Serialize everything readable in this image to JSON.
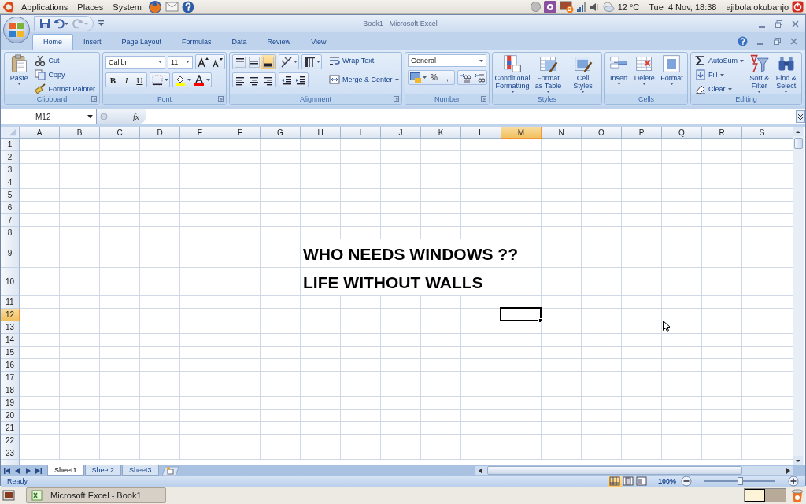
{
  "top_panel": {
    "menus": [
      "Applications",
      "Places",
      "System"
    ],
    "weather": "12 °C",
    "clock": "Tue  4 Nov, 18:38",
    "user": "ajibola okubanjo"
  },
  "window": {
    "title": "Book1 - Microsoft Excel"
  },
  "ribbon_tabs": [
    {
      "label": "Home",
      "selected": true
    },
    {
      "label": "Insert",
      "selected": false
    },
    {
      "label": "Page Layout",
      "selected": false
    },
    {
      "label": "Formulas",
      "selected": false
    },
    {
      "label": "Data",
      "selected": false
    },
    {
      "label": "Review",
      "selected": false
    },
    {
      "label": "View",
      "selected": false
    }
  ],
  "ribbon_groups": [
    {
      "kind": "clipboard",
      "label": "Clipboard",
      "large": [
        "Paste"
      ],
      "small": [
        "Cut",
        "Copy",
        "Format Painter"
      ]
    },
    {
      "kind": "font",
      "label": "Font",
      "font_name": "Calibri",
      "font_size": "11",
      "format_buttons": [
        "B",
        "I",
        "U"
      ]
    },
    {
      "kind": "alignment",
      "label": "Alignment",
      "vertical_align": [
        {
          "selected": false
        },
        {
          "selected": false
        },
        {
          "selected": true
        }
      ],
      "small": [
        "Wrap Text",
        "Merge & Center"
      ]
    },
    {
      "kind": "number",
      "label": "Number",
      "format": "General",
      "symbols": [
        "%",
        ","
      ]
    },
    {
      "kind": "styles",
      "label": "Styles",
      "large": [
        "Conditional Formatting",
        "Format as Table",
        "Cell Styles"
      ]
    },
    {
      "kind": "cells",
      "label": "Cells",
      "large": [
        "Insert",
        "Delete",
        "Format"
      ]
    },
    {
      "kind": "editing",
      "label": "Editing",
      "small": [
        "AutoSum",
        "Fill",
        "Clear"
      ],
      "large": [
        "Sort & Filter",
        "Find & Select"
      ]
    }
  ],
  "formula_bar": {
    "name_box": "M12",
    "function_label": "fx"
  },
  "columns": [
    {
      "label": "A",
      "selected": false
    },
    {
      "label": "B",
      "selected": false
    },
    {
      "label": "C",
      "selected": false
    },
    {
      "label": "D",
      "selected": false
    },
    {
      "label": "E",
      "selected": false
    },
    {
      "label": "F",
      "selected": false
    },
    {
      "label": "G",
      "selected": false
    },
    {
      "label": "H",
      "selected": false
    },
    {
      "label": "I",
      "selected": false
    },
    {
      "label": "J",
      "selected": false
    },
    {
      "label": "K",
      "selected": false
    },
    {
      "label": "L",
      "selected": false
    },
    {
      "label": "M",
      "selected": true
    },
    {
      "label": "N",
      "selected": false
    },
    {
      "label": "O",
      "selected": false
    },
    {
      "label": "P",
      "selected": false
    },
    {
      "label": "Q",
      "selected": false
    },
    {
      "label": "R",
      "selected": false
    },
    {
      "label": "S",
      "selected": false
    }
  ],
  "rows": [
    {
      "label": "1",
      "selected": false
    },
    {
      "label": "2",
      "selected": false
    },
    {
      "label": "3",
      "selected": false
    },
    {
      "label": "4",
      "selected": false
    },
    {
      "label": "5",
      "selected": false
    },
    {
      "label": "6",
      "selected": false
    },
    {
      "label": "7",
      "selected": false
    },
    {
      "label": "8",
      "selected": false
    },
    {
      "label": "9",
      "selected": false,
      "text": "WHO NEEDS WINDOWS ??"
    },
    {
      "label": "10",
      "selected": false,
      "text": "LIFE WITHOUT WALLS"
    },
    {
      "label": "11",
      "selected": false
    },
    {
      "label": "12",
      "selected": true
    },
    {
      "label": "13",
      "selected": false
    },
    {
      "label": "14",
      "selected": false
    },
    {
      "label": "15",
      "selected": false
    },
    {
      "label": "16",
      "selected": false
    },
    {
      "label": "17",
      "selected": false
    },
    {
      "label": "18",
      "selected": false
    },
    {
      "label": "19",
      "selected": false
    },
    {
      "label": "20",
      "selected": false
    },
    {
      "label": "21",
      "selected": false
    },
    {
      "label": "22",
      "selected": false
    },
    {
      "label": "23",
      "selected": false
    }
  ],
  "sheet_tabs": [
    {
      "label": "Sheet1",
      "selected": true
    },
    {
      "label": "Sheet2",
      "selected": false
    },
    {
      "label": "Sheet3",
      "selected": false
    }
  ],
  "status_bar": {
    "status": "Ready",
    "views": [
      {
        "selected": true
      },
      {
        "selected": false
      },
      {
        "selected": false
      }
    ],
    "zoom": "100%",
    "zoom_slider": {
      "level": 0.5
    }
  },
  "taskbar": {
    "windows": [
      "Microsoft Excel - Book1"
    ]
  }
}
